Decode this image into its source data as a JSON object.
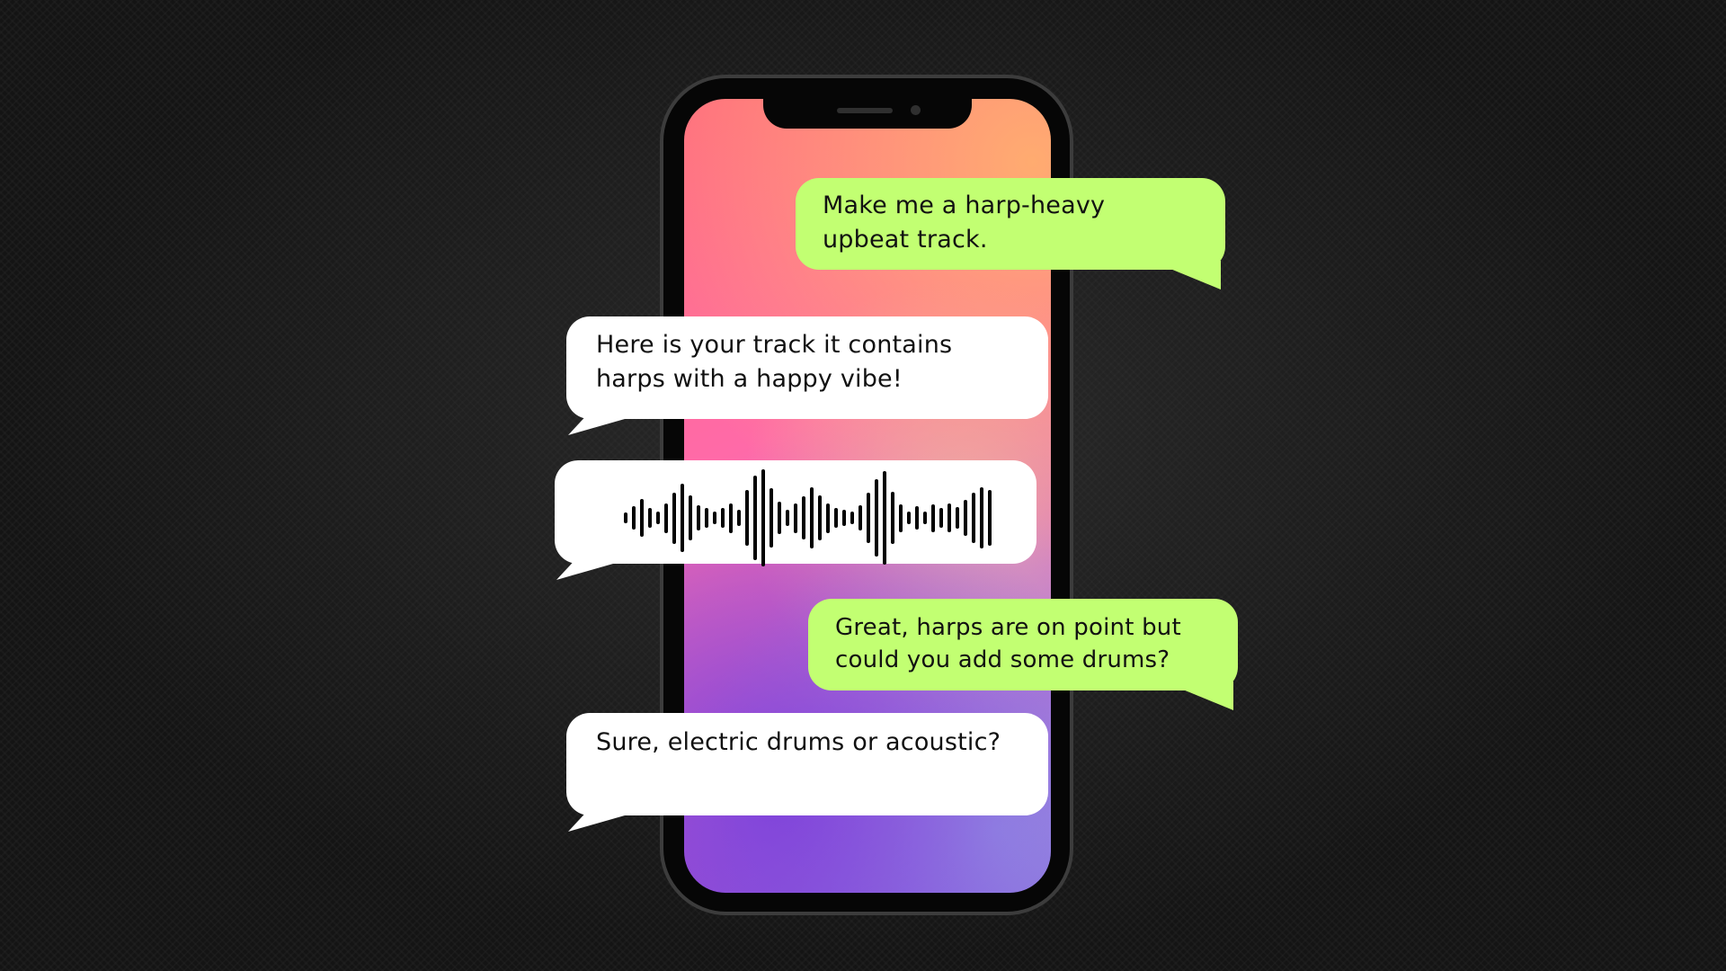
{
  "colors": {
    "user_bubble": "#c2ff72",
    "assistant_bubble": "#ffffff",
    "background": "#141414"
  },
  "messages": [
    {
      "role": "user",
      "text": "Make me a harp-heavy upbeat track."
    },
    {
      "role": "assistant",
      "text": "Here is your track it contains harps with a happy vibe!"
    },
    {
      "role": "assistant",
      "type": "audio",
      "icon": "audio-waveform-icon",
      "levels": [
        0.11,
        0.24,
        0.39,
        0.2,
        0.13,
        0.31,
        0.53,
        0.7,
        0.46,
        0.26,
        0.2,
        0.13,
        0.2,
        0.31,
        0.17,
        0.57,
        0.87,
        1.0,
        0.61,
        0.33,
        0.17,
        0.31,
        0.44,
        0.63,
        0.46,
        0.31,
        0.2,
        0.17,
        0.13,
        0.26,
        0.52,
        0.8,
        0.96,
        0.54,
        0.29,
        0.13,
        0.24,
        0.13,
        0.29,
        0.2,
        0.3,
        0.22,
        0.37,
        0.52,
        0.63,
        0.57
      ]
    },
    {
      "role": "user",
      "text": "Great, harps are on point but could you add some drums?"
    },
    {
      "role": "assistant",
      "text": "Sure, electric drums or acoustic?"
    }
  ]
}
